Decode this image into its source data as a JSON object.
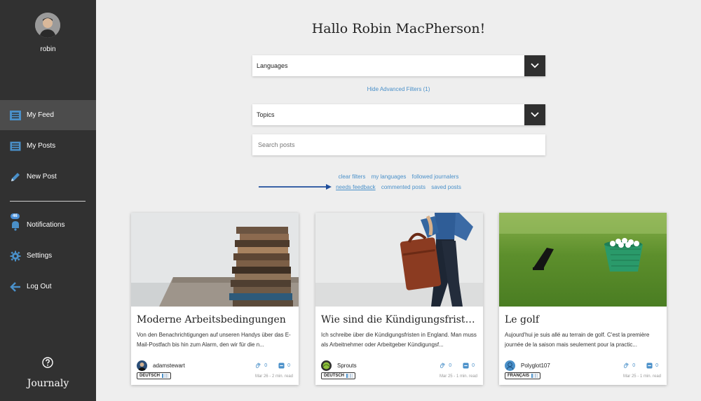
{
  "sidebar": {
    "username": "robin",
    "nav": [
      {
        "label": "My Feed",
        "icon": "feed-icon",
        "active": true
      },
      {
        "label": "My Posts",
        "icon": "posts-icon"
      },
      {
        "label": "New Post",
        "icon": "pencil-icon"
      },
      {
        "label": "Notifications",
        "icon": "bell-icon",
        "badge": "46"
      },
      {
        "label": "Settings",
        "icon": "gear-icon"
      },
      {
        "label": "Log Out",
        "icon": "logout-arrow-icon"
      }
    ],
    "logo": "Journaly"
  },
  "main": {
    "greeting": "Hallo Robin MacPherson!",
    "languages_label": "Languages",
    "hide_filters": "Hide Advanced Filters (1)",
    "topics_label": "Topics",
    "search_placeholder": "Search posts",
    "filters_row1": [
      "clear filters",
      "my languages",
      "followed journalers"
    ],
    "filters_row2": [
      "needs feedback",
      "commented posts",
      "saved posts"
    ]
  },
  "cards": [
    {
      "title": "Moderne Arbeitsbedingungen",
      "excerpt": "Von den Benachrichtigungen auf unseren Handys über das E-Mail-Postfach bis hin zum Alarm, den wir für die n...",
      "author": "adamstewart",
      "likes": "0",
      "comments": "0",
      "language": "DEUTSCH",
      "level": 1,
      "date": "Mar 26 - 2 min. read"
    },
    {
      "title": "Wie sind die Kündigungsfristen in England?",
      "excerpt": "Ich schreibe über die Kündigungsfristen in England. Man muss als Arbeitnehmer oder Arbeitgeber Kündigungsf...",
      "author": "Sprouts",
      "likes": "0",
      "comments": "0",
      "language": "DEUTSCH",
      "level": 1,
      "date": "Mar 25 - 1 min. read"
    },
    {
      "title": "Le golf",
      "excerpt": "Aujourd'hui je suis allé au terrain de golf. C'est la première journée de la saison mais seulement pour la practic...",
      "author": "Polyglot107",
      "likes": "0",
      "comments": "0",
      "language": "FRANÇAIS",
      "level": 1,
      "date": "Mar 25 - 1 min. read"
    }
  ],
  "colors": {
    "sidebar_bg": "#313131",
    "sidebar_active": "#4c4c4c",
    "accent": "#4a90c9",
    "page_bg": "#eeeeee"
  }
}
